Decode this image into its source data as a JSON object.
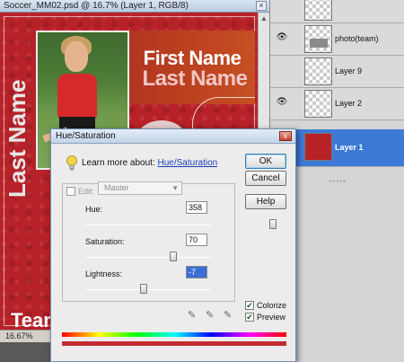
{
  "document": {
    "title": "Soccer_MM02.psd @ 16.7% (Layer 1, RGB/8)",
    "close_glyph": "×",
    "canvas_text": {
      "first_name": "First Name",
      "last_name": "Last Name",
      "vertical_name": "Last Name",
      "team": "Team"
    },
    "zoom_level": "16.67%"
  },
  "layers": [
    {
      "name": "",
      "thumbnail": "transparent",
      "visible": false
    },
    {
      "name": "photo(team)",
      "thumbnail": "team",
      "visible": true
    },
    {
      "name": "Layer 9",
      "thumbnail": "transparent",
      "visible": false
    },
    {
      "name": "Layer 2",
      "thumbnail": "transparent",
      "visible": true
    },
    {
      "name": "Layer 1",
      "thumbnail": "red",
      "visible": true,
      "selected": true
    }
  ],
  "dialog": {
    "title": "Hue/Saturation",
    "close_glyph": "x",
    "learn_prefix": "Learn more about:",
    "learn_link": "Hue/Saturation",
    "buttons": {
      "ok": "OK",
      "cancel": "Cancel",
      "help": "Help"
    },
    "edit_label": "Edit:",
    "edit_value": "Master",
    "hue": {
      "label": "Hue:",
      "value": "358",
      "min": -180,
      "max": 180
    },
    "saturation": {
      "label": "Saturation:",
      "value": "70",
      "min": 0,
      "max": 100
    },
    "lightness": {
      "label": "Lightness:",
      "value": "-7",
      "min": -100,
      "max": 100
    },
    "colorize": {
      "label": "Colorize",
      "checked": true
    },
    "preview": {
      "label": "Preview",
      "checked": true
    }
  },
  "colors": {
    "canvas_red": "#b72229",
    "selected_layer": "#3d7ad8",
    "link": "#1a3fbd"
  }
}
